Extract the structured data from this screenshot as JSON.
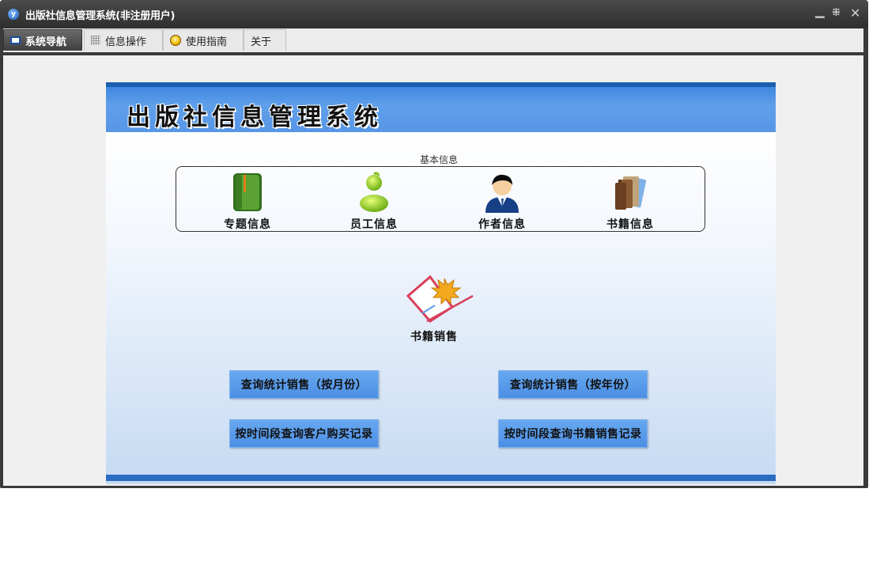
{
  "window": {
    "title": "出版社信息管理系统(非注册用户)",
    "app_icon_glyph": "y"
  },
  "tabs": [
    {
      "label": "系统导航",
      "icon": "monitor-icon",
      "active": true
    },
    {
      "label": "信息操作",
      "icon": "grid-icon",
      "active": false
    },
    {
      "label": "使用指南",
      "icon": "lightbulb-icon",
      "active": false
    },
    {
      "label": "关于",
      "icon": "",
      "active": false
    }
  ],
  "panel": {
    "title": "出版社信息管理系统",
    "basic_info": {
      "caption": "基本信息",
      "items": [
        {
          "label": "专题信息",
          "icon": "green-book-icon"
        },
        {
          "label": "员工信息",
          "icon": "green-person-icon"
        },
        {
          "label": "作者信息",
          "icon": "businessman-icon"
        },
        {
          "label": "书籍信息",
          "icon": "books-stack-icon"
        }
      ]
    },
    "sales": {
      "label": "书籍销售",
      "icon": "maple-leaf-book-icon"
    },
    "buttons": [
      "查询统计销售（按月份）",
      "查询统计销售（按年份）",
      "按时间段查询客户购买记录",
      "按时间段查询书籍销售记录"
    ]
  },
  "colors": {
    "header_blue": "#5796e6",
    "accent_blue": "#1b5fb0",
    "button_blue": "#5b9cea"
  }
}
